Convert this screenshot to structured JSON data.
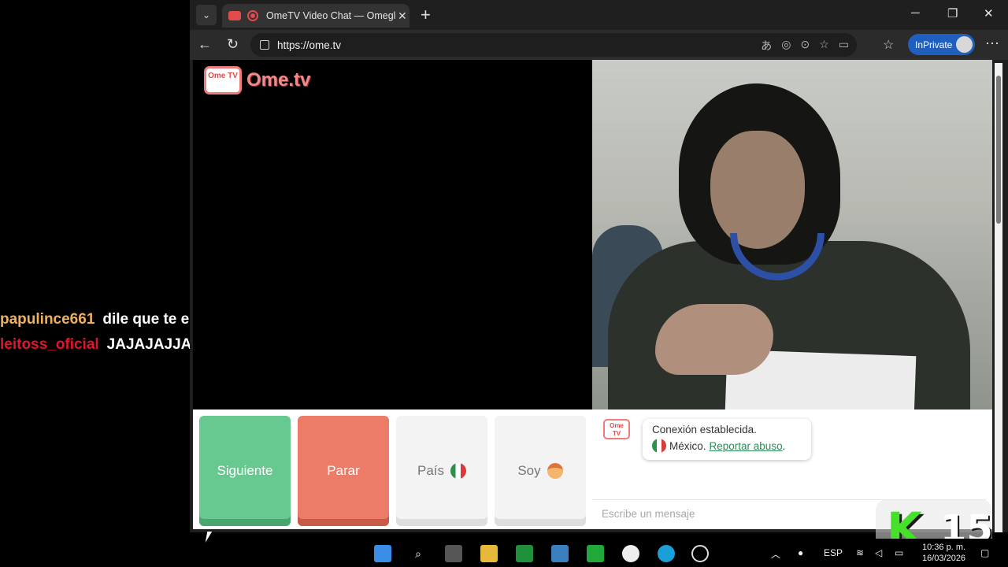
{
  "stream_chat": [
    {
      "user": "papulince661",
      "user_color": "#f0b060",
      "message": "dile que te enseñe sus bubis"
    },
    {
      "user": "leitoss_oficial",
      "user_color": "#e0142a",
      "message": "JAJAJAJJAA"
    }
  ],
  "browser": {
    "tab_title": "OmeTV Video Chat — Omegle",
    "url": "https://ome.tv",
    "inprivate_label": "InPrivate"
  },
  "page": {
    "logo": {
      "tv_text": "Ome TV",
      "brand_text": "Ome.tv"
    },
    "buttons": {
      "next": "Siguiente",
      "stop": "Parar",
      "country": "País",
      "gender": "Soy"
    },
    "chat": {
      "logo_text": "Ome TV",
      "status": "Conexión establecida.",
      "country": "México.",
      "report": "Reportar abuso",
      "report_suffix": ".",
      "input_placeholder": "Escribe un mensaje"
    }
  },
  "badge": {
    "number": "15",
    "letter": "K"
  },
  "taskbar": {
    "lang": "ESP",
    "time": "10:36 p. m.",
    "date": "16/03/2026"
  },
  "colors": {
    "next_button": "#67c98f",
    "stop_button": "#ec7b67",
    "inprivate": "#1f5fbf",
    "brand_red": "#e24b4b",
    "report_link": "#2d8a57"
  }
}
